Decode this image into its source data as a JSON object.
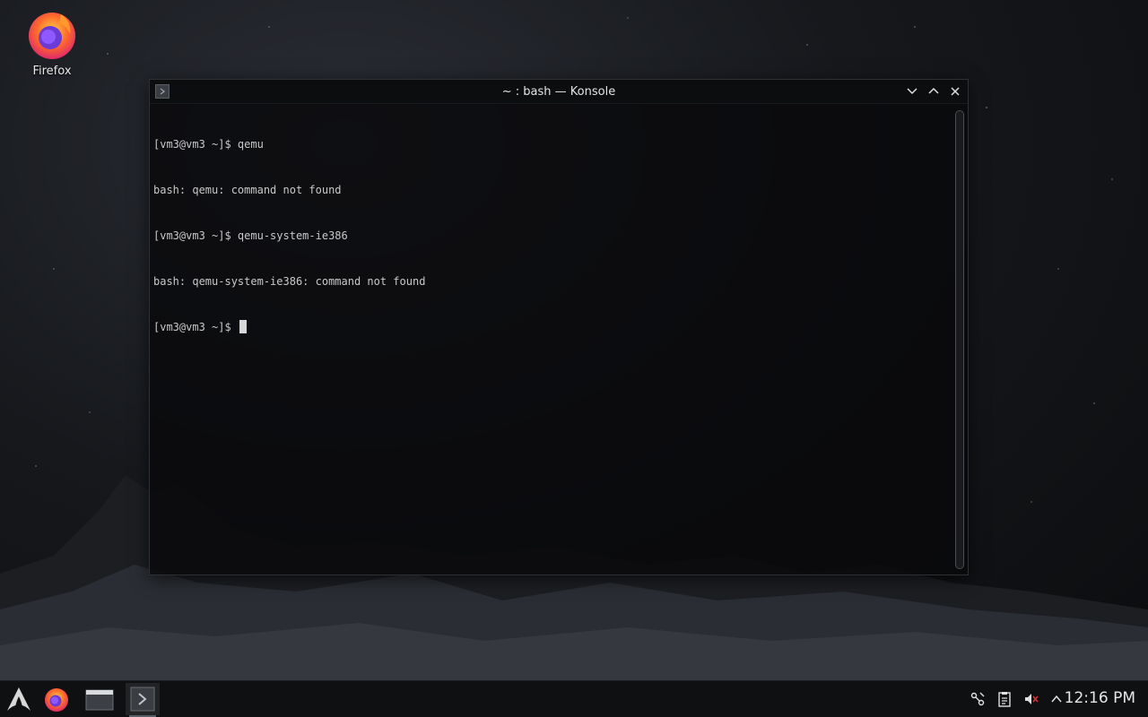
{
  "desktop": {
    "icons": [
      {
        "label": "Firefox",
        "icon": "firefox-icon"
      }
    ]
  },
  "window": {
    "title": "~ : bash — Konsole",
    "app_icon": "konsole-icon",
    "controls": [
      "minimize-icon",
      "maximize-icon",
      "close-icon"
    ]
  },
  "terminal": {
    "lines": [
      "[vm3@vm3 ~]$ qemu",
      "bash: qemu: command not found",
      "[vm3@vm3 ~]$ qemu-system-ie386",
      "bash: qemu-system-ie386: command not found",
      "[vm3@vm3 ~]$ "
    ]
  },
  "taskbar": {
    "items": [
      {
        "name": "application-launcher",
        "icon": "arch-linux-icon"
      },
      {
        "name": "firefox",
        "icon": "firefox-icon"
      },
      {
        "name": "file-manager",
        "icon": "folder-icon"
      },
      {
        "name": "konsole",
        "icon": "terminal-icon",
        "active": true
      }
    ],
    "tray": [
      "network-icon",
      "clipboard-icon",
      "volume-muted-icon",
      "expand-tray-icon"
    ],
    "clock": "12:16 PM"
  },
  "colors": {
    "terminal_text": "#c8c8c8",
    "titlebar": "#0c0d0f",
    "taskbar": "#0f1012"
  }
}
